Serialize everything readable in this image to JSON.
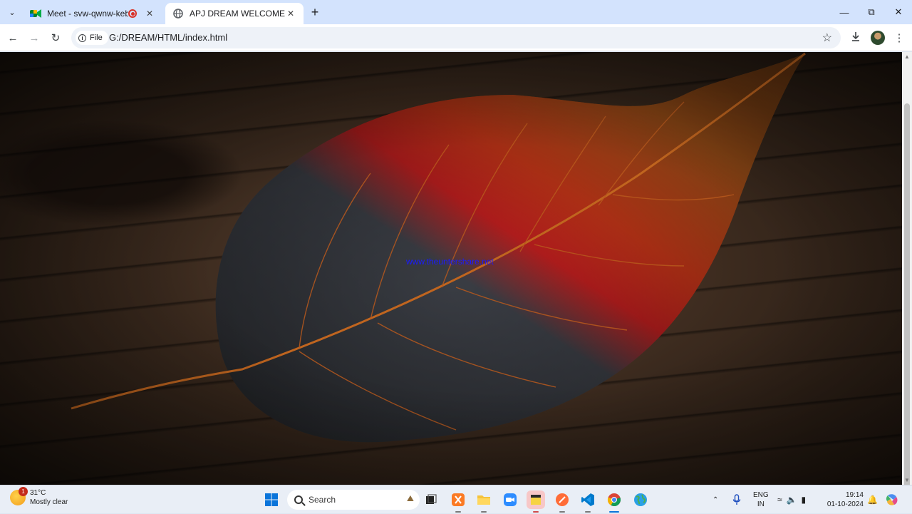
{
  "browser": {
    "tabs": [
      {
        "title": "Meet - svw-qwnw-keb",
        "active": false,
        "favicon": "google-meet-icon",
        "recording": true
      },
      {
        "title": "APJ DREAM WELCOMES",
        "active": true,
        "favicon": "globe-icon"
      }
    ],
    "address": {
      "scheme_label": "File",
      "url": "G:/DREAM/HTML/index.html"
    }
  },
  "page": {
    "background": "autumn-leaf-on-wood-photo",
    "link_text": "www.theuntershare.net",
    "link_color": "#1a1aff"
  },
  "taskbar": {
    "weather": {
      "temperature": "31°C",
      "condition": "Mostly clear",
      "badge": "1"
    },
    "search_placeholder": "Search",
    "apps": [
      "start-icon",
      "task-view-icon",
      "xampp-icon",
      "file-explorer-icon",
      "zoom-icon",
      "sticky-notes-icon",
      "postman-icon",
      "vscode-icon",
      "chrome-icon",
      "globe-app-icon"
    ],
    "tray": {
      "language_line1": "ENG",
      "language_line2": "IN",
      "time": "19:14",
      "date": "01-10-2024"
    }
  }
}
